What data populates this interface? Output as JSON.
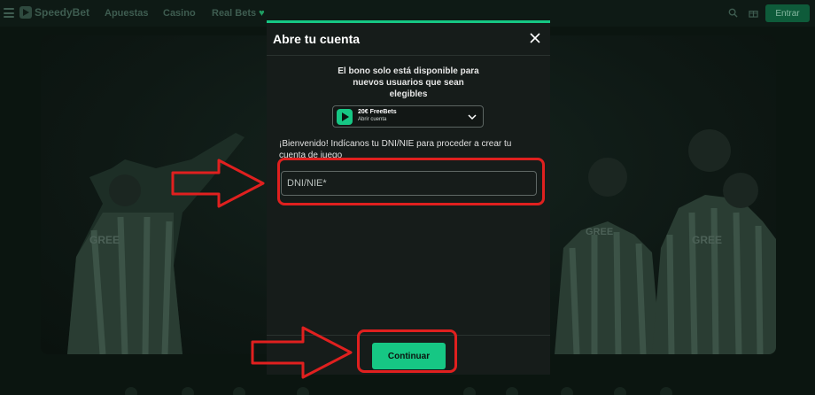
{
  "nav": {
    "brand": "SpeedyBet",
    "links": [
      "Apuestas",
      "Casino",
      "Real Bets"
    ],
    "login_label": "Entrar"
  },
  "modal": {
    "title": "Abre tu cuenta",
    "bonus_text": "El bono solo está disponible para\nnuevos usuarios que sean\nelegibles",
    "bonus_option": {
      "name": "20€ FreeBets",
      "subtitle": "Abrir cuenta"
    },
    "welcome_text": "¡Bienvenido! Indícanos tu DNI/NIE para proceder a crear tu cuenta de juego",
    "dni_placeholder": "DNI/NIE*",
    "continue_label": "Continuar"
  },
  "colors": {
    "accent": "#16c784",
    "annotation": "#e0201f",
    "background": "#0b1510"
  }
}
